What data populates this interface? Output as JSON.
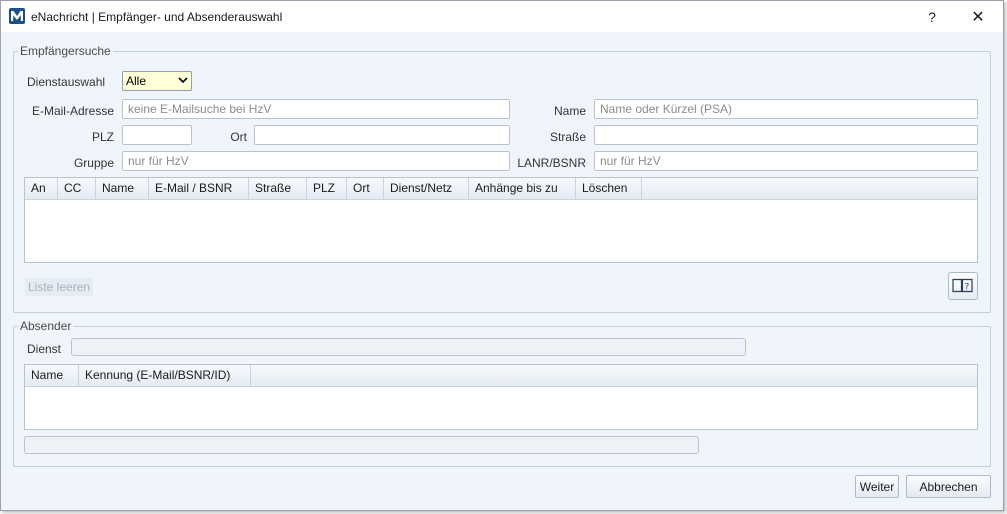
{
  "window": {
    "title": "eNachricht | Empfänger- und Absenderauswahl",
    "help_label": "?",
    "close_label": "✕"
  },
  "recipient": {
    "legend": "Empfängersuche",
    "service_label": "Dienstauswahl",
    "service_value": "Alle",
    "email_label": "E-Mail-Adresse",
    "email_placeholder": "keine E-Mailsuche bei HzV",
    "name_label": "Name",
    "name_placeholder": "Name oder Kürzel (PSA)",
    "plz_label": "PLZ",
    "plz_value": "",
    "ort_label": "Ort",
    "ort_value": "",
    "strasse_label": "Straße",
    "strasse_value": "",
    "gruppe_label": "Gruppe",
    "gruppe_placeholder": "nur für HzV",
    "lanr_label": "LANR/BSNR",
    "lanr_placeholder": "nur für HzV",
    "columns": [
      "An",
      "CC",
      "Name",
      "E-Mail / BSNR",
      "Straße",
      "PLZ",
      "Ort",
      "Dienst/Netz",
      "Anhänge bis zu",
      "Löschen"
    ],
    "clear_list_label": "Liste leeren",
    "help_book_icon": "help-book-icon"
  },
  "sender": {
    "legend": "Absender",
    "service_label": "Dienst",
    "columns": [
      "Name",
      "Kennung (E-Mail/BSNR/ID)"
    ]
  },
  "footer": {
    "next_label": "Weiter",
    "cancel_label": "Abbrechen"
  }
}
